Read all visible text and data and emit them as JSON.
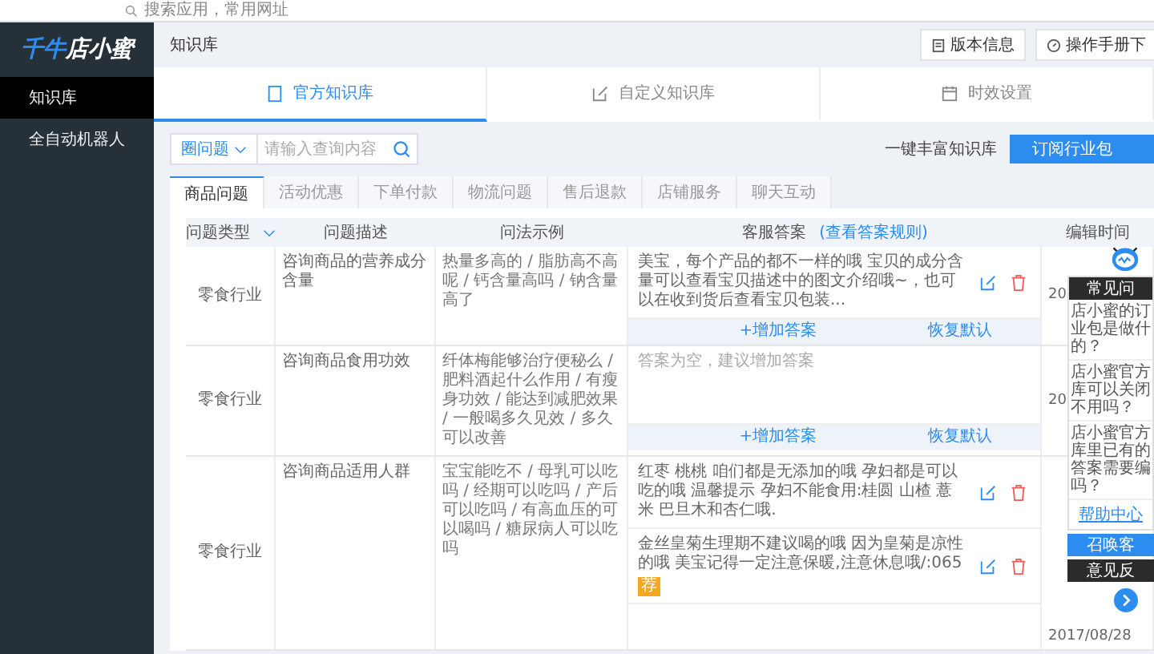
{
  "browser": {
    "address": "搜索应用，常用网址"
  },
  "sidebar": {
    "brand": "千牛",
    "product": "店小蜜",
    "items": [
      {
        "label": "知识库",
        "selected": true
      },
      {
        "label": "全自动机器人",
        "selected": false
      }
    ]
  },
  "header": {
    "title": "知识库",
    "buttons": [
      {
        "label": "版本信息",
        "kind": "info"
      },
      {
        "label": "操作手册下",
        "kind": "manual"
      }
    ]
  },
  "main_tabs": [
    {
      "label": "官方知识库",
      "kind": "doc",
      "selected": true
    },
    {
      "label": "自定义知识库",
      "kind": "edit",
      "selected": false
    },
    {
      "label": "时效设置",
      "kind": "calendar",
      "selected": false
    }
  ],
  "search": {
    "scope": "圈问题",
    "placeholder": "请输入查询内容"
  },
  "enrich_link": "一键丰富知识库",
  "subscribe_button": "订阅行业包",
  "category_tabs": [
    {
      "label": "商品问题",
      "selected": true
    },
    {
      "label": "活动优惠",
      "selected": false
    },
    {
      "label": "下单付款",
      "selected": false
    },
    {
      "label": "物流问题",
      "selected": false
    },
    {
      "label": "售后退款",
      "selected": false
    },
    {
      "label": "店铺服务",
      "selected": false
    },
    {
      "label": "聊天互动",
      "selected": false
    }
  ],
  "table": {
    "columns": [
      "问题类型",
      "问题描述",
      "问法示例",
      "客服答案",
      "编辑时间"
    ],
    "answer_rule_link": "(查看答案规则)",
    "rows": [
      {
        "type": "零食行业",
        "description": "咨询商品的营养成分含量",
        "examples": "热量多高的 / 脂肪高不高呢 / 钙含量高吗 / 钠含量高了",
        "answers": [
          {
            "kind": "answer",
            "text": "美宝，每个产品的都不一样的哦 宝贝的成分含量可以查看宝贝描述中的图文介绍哦~，也可以在收到货后查看宝贝包装..."
          }
        ],
        "add_answer": "+增加答案",
        "restore": "恢复默认",
        "time": "20"
      },
      {
        "type": "零食行业",
        "description": "咨询商品食用功效",
        "examples": "纤体梅能够治疗便秘么 / 肥料酒起什么作用 / 有瘦身功效 / 能达到减肥效果 / 一般喝多久见效 / 多久可以改善",
        "answers": [
          {
            "kind": "empty",
            "text": "答案为空，建议增加答案"
          }
        ],
        "add_answer": "+增加答案",
        "restore": "恢复默认",
        "time": "20"
      },
      {
        "type": "零食行业",
        "description": "咨询商品适用人群",
        "examples": "宝宝能吃不 / 母乳可以吃吗 / 经期可以吃吗 / 产后可以吃吗 / 有高血压的可以喝吗 / 糖尿病人可以吃吗",
        "answers": [
          {
            "kind": "answer",
            "text": "红枣 桃桃 咱们都是无添加的哦 孕妇都是可以吃的哦 温馨提示 孕妇不能食用:桂圆 山楂 薏米 巴旦木和杏仁哦."
          },
          {
            "kind": "answer",
            "text": "金丝皇菊生理期不建议喝的哦 因为皇菊是凉性的哦 美宝记得一定注意保暖,注意休息哦/:065",
            "tag": "荐"
          }
        ],
        "time": "2017/08/28"
      }
    ]
  },
  "help_widget": {
    "title": "常见问",
    "questions": [
      {
        "lines": [
          "店小蜜的订",
          "业包是做什",
          "的？"
        ]
      },
      {
        "lines": [
          "店小蜜官方",
          "库可以关闭",
          "不用吗？"
        ]
      },
      {
        "lines": [
          "店小蜜官方",
          "库里已有的",
          "答案需要编",
          "吗？"
        ]
      }
    ],
    "help_link": "帮助中心",
    "call_button": "召唤客",
    "feedback_button": "意见反"
  }
}
